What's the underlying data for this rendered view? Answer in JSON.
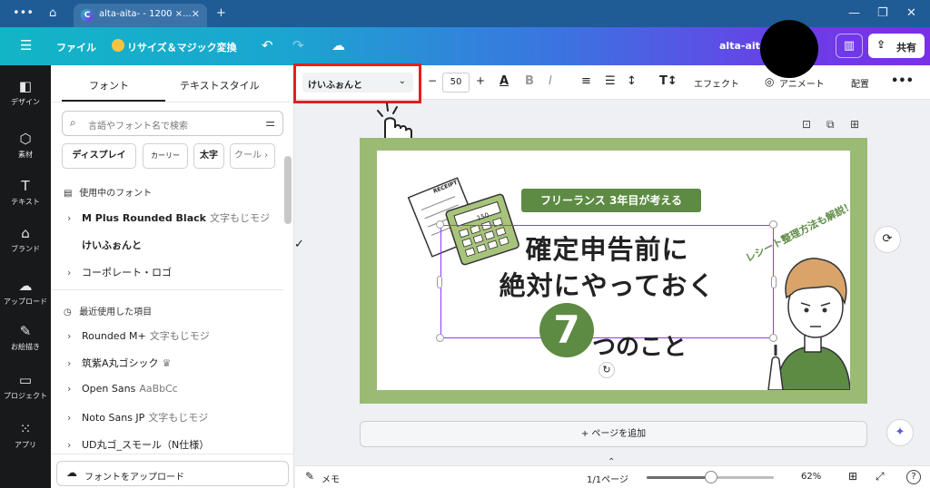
{
  "browser": {
    "tab_title": "alta-aita- - 1200 ×...",
    "tab_favicon": "C",
    "icons": [
      "more-icon",
      "home-icon",
      "close-icon",
      "new-tab-icon",
      "minimize-icon",
      "restore-icon",
      "window-close-icon"
    ]
  },
  "header": {
    "menu_icon": "hamburger-icon",
    "file": "ファイル",
    "resize": "リサイズ＆マジック変換",
    "doc_name": "alta-aita-",
    "share": "共有"
  },
  "rail": [
    {
      "label": "デザイン",
      "icon": "design-icon",
      "glyph": "◧"
    },
    {
      "label": "素材",
      "icon": "elements-icon",
      "glyph": "⬡"
    },
    {
      "label": "テキスト",
      "icon": "text-icon",
      "glyph": "T"
    },
    {
      "label": "ブランド",
      "icon": "brand-icon",
      "glyph": "⌂"
    },
    {
      "label": "アップロード",
      "icon": "upload-icon",
      "glyph": "☁"
    },
    {
      "label": "お絵描き",
      "icon": "draw-icon",
      "glyph": "✎"
    },
    {
      "label": "プロジェクト",
      "icon": "folder-icon",
      "glyph": "▭"
    },
    {
      "label": "アプリ",
      "icon": "apps-icon",
      "glyph": "⁙"
    }
  ],
  "panel": {
    "tabs": [
      "フォント",
      "テキストスタイル"
    ],
    "search_placeholder": "言語やフォント名で検索",
    "chips": [
      "ディスプレイ",
      "カーリー",
      "太字",
      "クール"
    ],
    "in_use_title": "使用中のフォント",
    "in_use": [
      {
        "name": "M Plus Rounded Black",
        "sample": "文字もじモジ",
        "chevron": "›",
        "checked": ""
      },
      {
        "name": "けいふぉんと",
        "sample": "",
        "chevron": "",
        "checked": "✓"
      },
      {
        "name": "コーポレート・ロゴ",
        "sample": "",
        "chevron": "›",
        "checked": ""
      }
    ],
    "recent_title": "最近使用した項目",
    "recent": [
      {
        "name": "Rounded M+",
        "sample": "文字もじモジ"
      },
      {
        "name": "筑紫A丸ゴシック",
        "sample": "♛"
      },
      {
        "name": "Open Sans",
        "sample": "AaBbCc"
      },
      {
        "name": "Noto Sans JP",
        "sample": "文字もじモジ"
      },
      {
        "name": "UD丸ゴ_スモール（N仕様）",
        "sample": ""
      }
    ],
    "upload_font": "フォントをアップロード"
  },
  "toolbar": {
    "font": "けいふぉんと",
    "size": "50",
    "minus": "−",
    "plus": "+",
    "effect": "エフェクト",
    "animate": "アニメート",
    "position": "配置"
  },
  "canvas": {
    "tag": "フリーランス 3年目が考える",
    "line1": "確定申告前に",
    "line2": "絶対にやっておく",
    "number": "7",
    "rest": "つのこと",
    "curve": "レシート整理方法も解説！",
    "receipt_label": "RECEIPT",
    "calc_display": "150",
    "add_page": "+ ページを追加"
  },
  "bottom": {
    "notes": "メモ",
    "pages": "1/1ページ",
    "zoom": "62%",
    "zoom_fraction": 0.5
  },
  "colors": {
    "accent_green": "#5d8b44",
    "selection": "#8b3dff",
    "highlight_red": "#e4201e"
  }
}
